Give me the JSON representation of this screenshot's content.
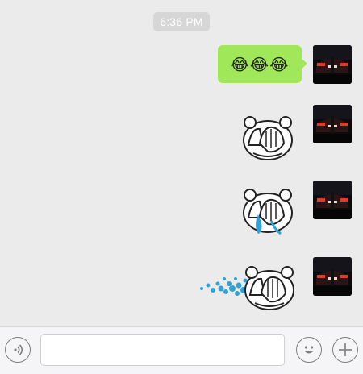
{
  "chat": {
    "timestamp": "6:36 PM",
    "messages": [
      {
        "type": "text",
        "content": "😂😂😂",
        "sender": "me"
      },
      {
        "type": "sticker",
        "sticker": "face-palm-bear-sticker"
      },
      {
        "type": "sticker",
        "sticker": "crying-bear-sticker"
      },
      {
        "type": "sticker",
        "sticker": "tears-spray-bear-sticker"
      }
    ]
  },
  "toolbar": {
    "voice_icon": "voice-icon",
    "input_value": "",
    "input_placeholder": "",
    "emoji_icon": "emoji-icon",
    "add_icon": "plus-icon"
  },
  "colors": {
    "background": "#ebebeb",
    "bubble": "#a0e75a",
    "timestamp_bg": "#d6d6d6",
    "tears": "#2fa3d6"
  }
}
